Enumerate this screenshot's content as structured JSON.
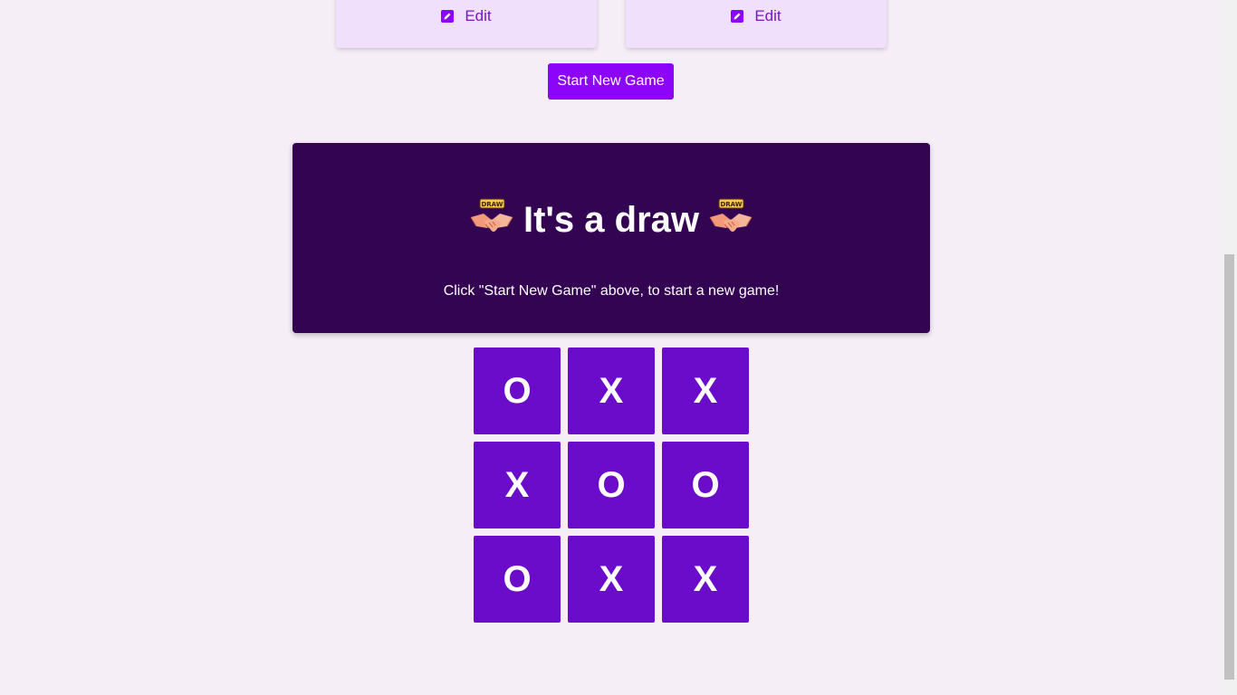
{
  "players": [
    {
      "edit_label": "Edit"
    },
    {
      "edit_label": "Edit"
    }
  ],
  "controls": {
    "start_new_game_label": "Start New Game"
  },
  "result": {
    "title": "It's a draw",
    "emoji_badge_text": "DRAW",
    "subtitle": "Click \"Start New Game\" above, to start a new game!"
  },
  "board": {
    "cells": [
      "O",
      "X",
      "X",
      "X",
      "O",
      "O",
      "O",
      "X",
      "X"
    ]
  },
  "colors": {
    "background": "#f6eef7",
    "accent": "#8d05f8",
    "cell": "#6b0ccb",
    "panel": "#330452",
    "card": "#f0e0fc",
    "edit_text": "#7a14c9"
  }
}
